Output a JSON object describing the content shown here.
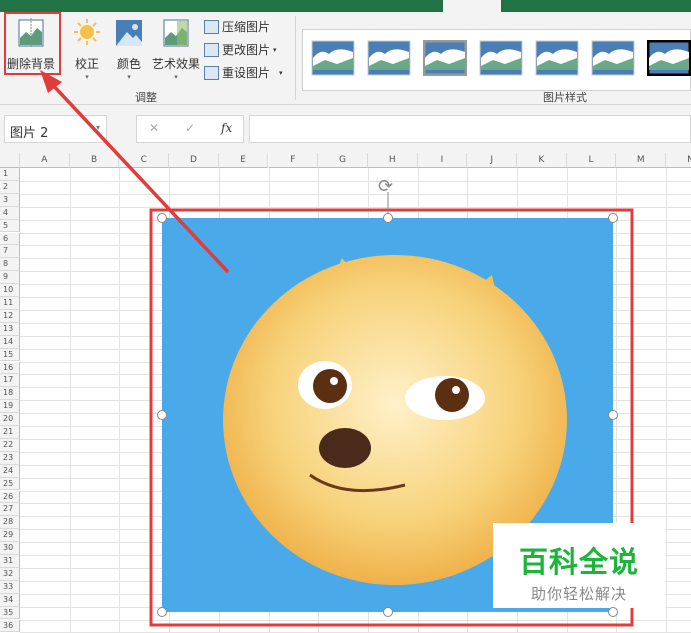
{
  "ribbon": {
    "remove_background": "删除背景",
    "corrections": "校正",
    "color": "颜色",
    "artistic_effects": "艺术效果",
    "compress": "压缩图片",
    "change": "更改图片",
    "reset": "重设图片",
    "group_adjust": "调整",
    "group_styles": "图片样式",
    "style_count": 7
  },
  "formula_bar": {
    "name_box": "图片 2",
    "cancel": "✕",
    "enter": "✓",
    "fx": "fx",
    "value": ""
  },
  "grid": {
    "columns": [
      "A",
      "B",
      "C",
      "D",
      "E",
      "F",
      "G",
      "H",
      "I",
      "J",
      "K",
      "L",
      "M",
      "N"
    ],
    "row_count": 36
  },
  "watermark": {
    "title": "百科全说",
    "subtitle": "助你轻松解决"
  },
  "colors": {
    "excel_green": "#217346",
    "highlight_red": "#e03c3c",
    "watermark_green": "#1db43a",
    "image_bg": "#4aa9e8"
  }
}
